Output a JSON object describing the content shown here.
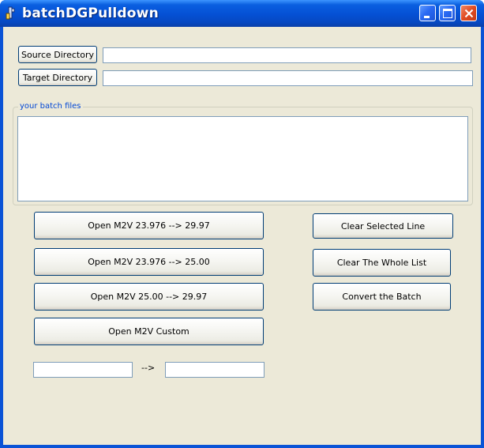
{
  "window": {
    "title": "batchDGPulldown"
  },
  "directories": {
    "source_label": "Source Directory",
    "source_value": "",
    "target_label": "Target Directory",
    "target_value": ""
  },
  "batch": {
    "group_label": "your batch files",
    "items": []
  },
  "buttons": {
    "open_23976_2997": "Open M2V 23.976 --> 29.97",
    "open_23976_2500": "Open M2V 23.976 --> 25.00",
    "open_2500_2997": "Open M2V 25.00 --> 29.97",
    "open_custom": "Open M2V Custom",
    "clear_selected": "Clear Selected Line",
    "clear_whole": "Clear The Whole List",
    "convert": "Convert the Batch"
  },
  "custom": {
    "from_value": "",
    "arrow": "-->",
    "to_value": ""
  }
}
